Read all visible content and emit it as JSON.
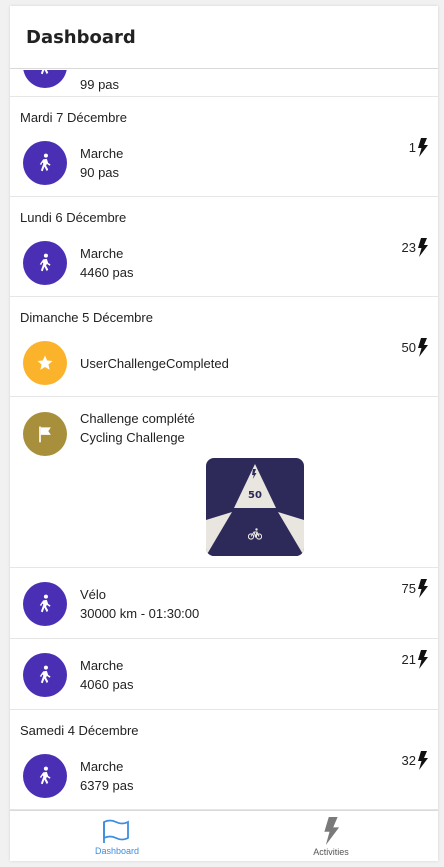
{
  "header": {
    "title": "Dashboard"
  },
  "colors": {
    "activity": "#4a2fb4",
    "challenge_star": "#fbb32b",
    "challenge_flag": "#a88f3c",
    "accent": "#3d8ee0",
    "badge_bg": "#2d2a5a"
  },
  "feed": {
    "partial_item": {
      "line2": "99 pas",
      "icon": "walking-person-icon"
    },
    "days": [
      {
        "label": "Mardi 7 Décembre"
      },
      {
        "label": "Lundi 6 Décembre"
      },
      {
        "label": "Dimanche 5 Décembre"
      },
      {
        "label": "Samedi 4 Décembre"
      }
    ],
    "items": [
      {
        "line1": "Marche",
        "line2": "90 pas",
        "points": "1",
        "icon": "walking-person-icon"
      },
      {
        "line1": "Marche",
        "line2": "4460 pas",
        "points": "23",
        "icon": "walking-person-icon"
      },
      {
        "line1": "UserChallengeCompleted",
        "points": "50",
        "icon": "star-icon"
      },
      {
        "line1": "Challenge complété",
        "line2": "Cycling Challenge",
        "icon": "flag-icon",
        "badge_value": "50",
        "badge_icon": "bicycle-icon"
      },
      {
        "line1": "Vélo",
        "line2": "30000 km - 01:30:00",
        "points": "75",
        "icon": "walking-person-icon"
      },
      {
        "line1": "Marche",
        "line2": "4060 pas",
        "points": "21",
        "icon": "walking-person-icon"
      },
      {
        "line1": "Marche",
        "line2": "6379 pas",
        "points": "32",
        "icon": "walking-person-icon"
      }
    ]
  },
  "bottom_nav": {
    "tabs": [
      {
        "label": "Dashboard",
        "icon": "map-flag-icon",
        "active": true
      },
      {
        "label": "Activities",
        "icon": "lightning-icon",
        "active": false
      }
    ]
  }
}
